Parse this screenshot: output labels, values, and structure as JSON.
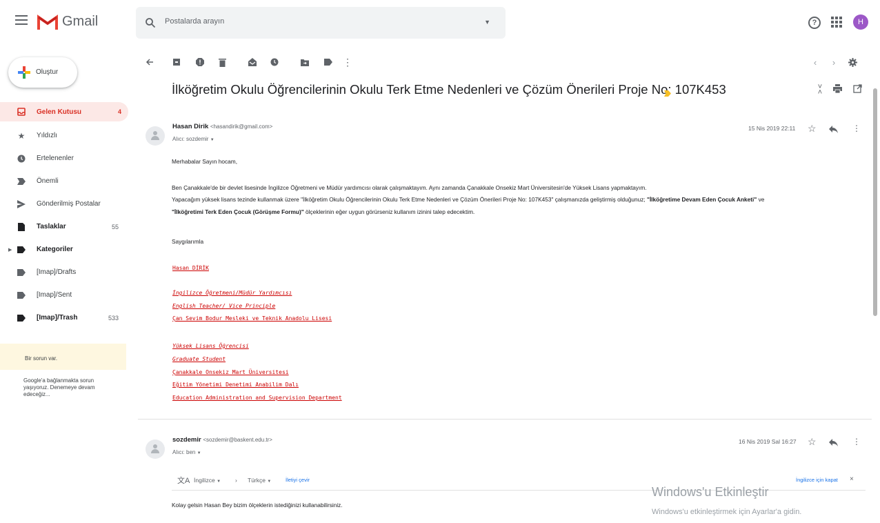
{
  "header": {
    "app_name": "Gmail",
    "search_placeholder": "Postalarda arayın",
    "avatar_letter": "H"
  },
  "sidebar": {
    "compose_label": "Oluştur",
    "items": [
      {
        "label": "Gelen Kutusu",
        "count": "4"
      },
      {
        "label": "Yıldızlı",
        "count": ""
      },
      {
        "label": "Ertelenenler",
        "count": ""
      },
      {
        "label": "Önemli",
        "count": ""
      },
      {
        "label": "Gönderilmiş Postalar",
        "count": ""
      },
      {
        "label": "Taslaklar",
        "count": "55"
      },
      {
        "label": "Kategoriler",
        "count": ""
      },
      {
        "label": "[Imap]/Drafts",
        "count": ""
      },
      {
        "label": "[Imap]/Sent",
        "count": ""
      },
      {
        "label": "[Imap]/Trash",
        "count": "533"
      }
    ],
    "warning_title": "Bir sorun var.",
    "warning_text": "Google'a bağlanmakta sorun yaşıyoruz. Denemeye devam edeceğiz..."
  },
  "thread": {
    "subject": "İlköğretim Okulu Öğrencilerinin Okulu Terk Etme Nedenleri ve Çözüm Önerileri Proje No: 107K453",
    "messages": [
      {
        "sender_name": "Hasan Dirik",
        "sender_address": "<hasandirik@gmail.com>",
        "recipient": "Alıcı: sozdemir",
        "date": "15 Nis 2019 22:11",
        "greeting": "Merhabalar Sayın hocam,",
        "para1": "Ben Çanakkale'de bir devlet lisesinde İngilizce Öğretmeni ve Müdür yardımcısı olarak çalışmaktayım. Aynı zamanda Çanakkale Onsekiz Mart Üniversitesin'de Yüksek Lisans yapmaktayım.",
        "para2_start": "Yapacağım yüksek lisans tezinde kullanmak üzere \"İlköğretim Okulu Öğrencilerinin Okulu Terk Etme Nedenleri ve Çözüm Önerileri Proje No: 107K453\" çalışmanızda geliştirmiş olduğunuz; ",
        "para2_bold1": "\"İlköğretime Devam Eden Çocuk Anketi\"",
        "para2_mid": " ve",
        "para3_bold2": "\"İlköğretimi Terk Eden Çocuk (Görüşme Formu)\"",
        "para3_end": " ölçeklerinin eğer uygun görürseniz kullanım izinini talep edecektim.",
        "closing": "Saygılarımla",
        "signature": [
          "Hasan DİRİK",
          "İngilizce Öğretmeni/Müdür Yardımcısı",
          "English Teacher/ Vice Principle",
          "Çan Sevim Bodur Mesleki ve Teknik Anadolu Lisesi",
          "Yüksek Lisans Öğrencisi",
          "Graduate Student",
          "Çanakkale Onsekiz Mart Üniversitesi",
          "Eğitim Yönetimi Denetimi Anabilim Dalı",
          "Education Administration and Supervision Department"
        ]
      },
      {
        "sender_name": "sozdemir",
        "sender_address": "<sozdemir@baskent.edu.tr>",
        "recipient": "Alıcı: ben",
        "date": "16 Nis 2019 Sal 16:27",
        "body": "Kolay gelsin Hasan Bey bizim ölçeklerin istediğinizi kullanabilirsiniz."
      }
    ],
    "translate": {
      "from": "İngilizce",
      "to": "Türkçe",
      "translate_link": "İletiyi çevir",
      "close_link": "İngilizce için kapat"
    }
  },
  "watermark": {
    "line1": "Windows'u Etkinleştir",
    "line2": "Windows'u etkinleştirmek için Ayarlar'a gidin."
  },
  "colors": {
    "accent_red": "#d93025",
    "active_bg": "#fce8e6",
    "label_yellow": "#f6bf26",
    "signature_red": "#cc0000",
    "avatar_purple": "#9c58c7"
  }
}
